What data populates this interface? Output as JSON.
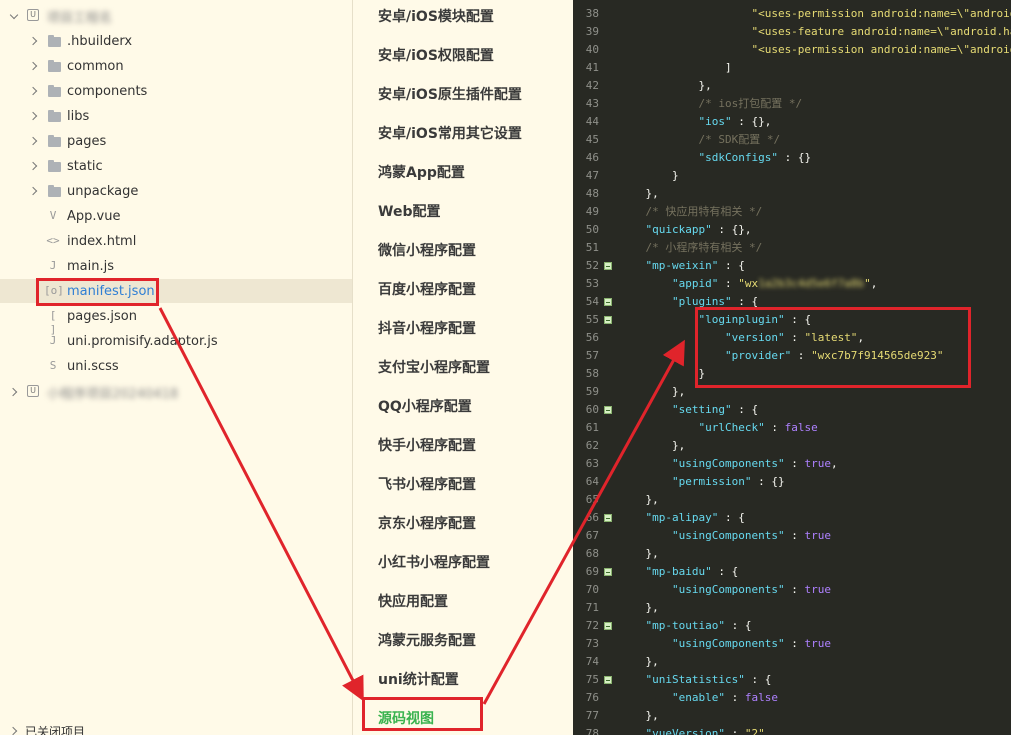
{
  "explorer": {
    "project_name": "项目工程名",
    "items": [
      {
        "label": ".hbuilderx",
        "kind": "folder"
      },
      {
        "label": "common",
        "kind": "folder"
      },
      {
        "label": "components",
        "kind": "folder"
      },
      {
        "label": "libs",
        "kind": "folder"
      },
      {
        "label": "pages",
        "kind": "folder"
      },
      {
        "label": "static",
        "kind": "folder"
      },
      {
        "label": "unpackage",
        "kind": "folder"
      },
      {
        "label": "App.vue",
        "kind": "vue-file"
      },
      {
        "label": "index.html",
        "kind": "html-file"
      },
      {
        "label": "main.js",
        "kind": "js-file"
      },
      {
        "label": "manifest.json",
        "kind": "manifest-file"
      },
      {
        "label": "pages.json",
        "kind": "json-file"
      },
      {
        "label": "uni.promisify.adaptor.js",
        "kind": "js-file"
      },
      {
        "label": "uni.scss",
        "kind": "scss-file"
      }
    ],
    "second_project_name": "小程序项目20240418",
    "closed_projects_label": "已关闭项目"
  },
  "config_menu": {
    "items": [
      "安卓/iOS模块配置",
      "安卓/iOS权限配置",
      "安卓/iOS原生插件配置",
      "安卓/iOS常用其它设置",
      "鸿蒙App配置",
      "Web配置",
      "微信小程序配置",
      "百度小程序配置",
      "抖音小程序配置",
      "支付宝小程序配置",
      "QQ小程序配置",
      "快手小程序配置",
      "飞书小程序配置",
      "京东小程序配置",
      "小红书小程序配置",
      "快应用配置",
      "鸿蒙元服务配置",
      "uni统计配置",
      "源码视图"
    ],
    "active_item": "源码视图"
  },
  "editor": {
    "lines": [
      {
        "n": "38",
        "fold": false,
        "parts": [
          [
            "s",
            "                    \"<uses-permission android:name=\\\"android.permission.ACCESS_FINE_LOCATION\\\"/>\","
          ]
        ]
      },
      {
        "n": "39",
        "fold": false,
        "parts": [
          [
            "s",
            "                    \"<uses-feature android:name=\\\"android.hardware.location\\\"/>\","
          ]
        ]
      },
      {
        "n": "40",
        "fold": false,
        "parts": [
          [
            "s",
            "                    \"<uses-permission android:name=\\\"android.permission.ACCESS_WIFI_STATE\\\"/>\""
          ]
        ]
      },
      {
        "n": "41",
        "fold": false,
        "parts": [
          [
            "p",
            "                ]"
          ]
        ]
      },
      {
        "n": "42",
        "fold": false,
        "parts": [
          [
            "p",
            "            },"
          ]
        ]
      },
      {
        "n": "43",
        "fold": false,
        "parts": [
          [
            "c",
            "            /* ios打包配置 */"
          ]
        ]
      },
      {
        "n": "44",
        "fold": false,
        "parts": [
          [
            "k",
            "            \"ios\""
          ],
          [
            "p",
            " : {},"
          ]
        ]
      },
      {
        "n": "45",
        "fold": false,
        "parts": [
          [
            "c",
            "            /* SDK配置 */"
          ]
        ]
      },
      {
        "n": "46",
        "fold": false,
        "parts": [
          [
            "k",
            "            \"sdkConfigs\""
          ],
          [
            "p",
            " : {}"
          ]
        ]
      },
      {
        "n": "47",
        "fold": false,
        "parts": [
          [
            "p",
            "        }"
          ]
        ]
      },
      {
        "n": "48",
        "fold": false,
        "parts": [
          [
            "p",
            "    },"
          ]
        ]
      },
      {
        "n": "49",
        "fold": false,
        "parts": [
          [
            "c",
            "    /* 快应用特有相关 */"
          ]
        ]
      },
      {
        "n": "50",
        "fold": false,
        "parts": [
          [
            "k",
            "    \"quickapp\""
          ],
          [
            "p",
            " : {},"
          ]
        ]
      },
      {
        "n": "51",
        "fold": false,
        "parts": [
          [
            "c",
            "    /* 小程序特有相关 */"
          ]
        ]
      },
      {
        "n": "52",
        "fold": true,
        "parts": [
          [
            "k",
            "    \"mp-weixin\""
          ],
          [
            "p",
            " : {"
          ]
        ]
      },
      {
        "n": "53",
        "fold": false,
        "parts": [
          [
            "k",
            "        \"appid\""
          ],
          [
            "p",
            " : "
          ],
          [
            "s",
            "\"wx"
          ],
          [
            "blur",
            "1a2b3c4d5e6f7a8b"
          ],
          [
            "s",
            "\""
          ],
          [
            "p",
            ","
          ]
        ]
      },
      {
        "n": "54",
        "fold": true,
        "parts": [
          [
            "k",
            "        \"plugins\""
          ],
          [
            "p",
            " : {"
          ]
        ]
      },
      {
        "n": "55",
        "fold": true,
        "parts": [
          [
            "k",
            "            \"loginplugin\""
          ],
          [
            "p",
            " : {"
          ]
        ]
      },
      {
        "n": "56",
        "fold": false,
        "parts": [
          [
            "k",
            "                \"version\""
          ],
          [
            "p",
            " : "
          ],
          [
            "s",
            "\"latest\""
          ],
          [
            "p",
            ","
          ]
        ]
      },
      {
        "n": "57",
        "fold": false,
        "parts": [
          [
            "k",
            "                \"provider\""
          ],
          [
            "p",
            " : "
          ],
          [
            "s",
            "\"wxc7b7f914565de923\""
          ]
        ]
      },
      {
        "n": "58",
        "fold": false,
        "parts": [
          [
            "p",
            "            }"
          ]
        ]
      },
      {
        "n": "59",
        "fold": false,
        "parts": [
          [
            "p",
            "        },"
          ]
        ]
      },
      {
        "n": "60",
        "fold": true,
        "parts": [
          [
            "k",
            "        \"setting\""
          ],
          [
            "p",
            " : {"
          ]
        ]
      },
      {
        "n": "61",
        "fold": false,
        "parts": [
          [
            "k",
            "            \"urlCheck\""
          ],
          [
            "p",
            " : "
          ],
          [
            "b",
            "false"
          ]
        ]
      },
      {
        "n": "62",
        "fold": false,
        "parts": [
          [
            "p",
            "        },"
          ]
        ]
      },
      {
        "n": "63",
        "fold": false,
        "parts": [
          [
            "k",
            "        \"usingComponents\""
          ],
          [
            "p",
            " : "
          ],
          [
            "b",
            "true"
          ],
          [
            "p",
            ","
          ]
        ]
      },
      {
        "n": "64",
        "fold": false,
        "parts": [
          [
            "k",
            "        \"permission\""
          ],
          [
            "p",
            " : {}"
          ]
        ]
      },
      {
        "n": "65",
        "fold": false,
        "parts": [
          [
            "p",
            "    },"
          ]
        ]
      },
      {
        "n": "66",
        "fold": true,
        "parts": [
          [
            "k",
            "    \"mp-alipay\""
          ],
          [
            "p",
            " : {"
          ]
        ]
      },
      {
        "n": "67",
        "fold": false,
        "parts": [
          [
            "k",
            "        \"usingComponents\""
          ],
          [
            "p",
            " : "
          ],
          [
            "b",
            "true"
          ]
        ]
      },
      {
        "n": "68",
        "fold": false,
        "parts": [
          [
            "p",
            "    },"
          ]
        ]
      },
      {
        "n": "69",
        "fold": true,
        "parts": [
          [
            "k",
            "    \"mp-baidu\""
          ],
          [
            "p",
            " : {"
          ]
        ]
      },
      {
        "n": "70",
        "fold": false,
        "parts": [
          [
            "k",
            "        \"usingComponents\""
          ],
          [
            "p",
            " : "
          ],
          [
            "b",
            "true"
          ]
        ]
      },
      {
        "n": "71",
        "fold": false,
        "parts": [
          [
            "p",
            "    },"
          ]
        ]
      },
      {
        "n": "72",
        "fold": true,
        "parts": [
          [
            "k",
            "    \"mp-toutiao\""
          ],
          [
            "p",
            " : {"
          ]
        ]
      },
      {
        "n": "73",
        "fold": false,
        "parts": [
          [
            "k",
            "        \"usingComponents\""
          ],
          [
            "p",
            " : "
          ],
          [
            "b",
            "true"
          ]
        ]
      },
      {
        "n": "74",
        "fold": false,
        "parts": [
          [
            "p",
            "    },"
          ]
        ]
      },
      {
        "n": "75",
        "fold": true,
        "parts": [
          [
            "k",
            "    \"uniStatistics\""
          ],
          [
            "p",
            " : {"
          ]
        ]
      },
      {
        "n": "76",
        "fold": false,
        "parts": [
          [
            "k",
            "        \"enable\""
          ],
          [
            "p",
            " : "
          ],
          [
            "b",
            "false"
          ]
        ]
      },
      {
        "n": "77",
        "fold": false,
        "parts": [
          [
            "p",
            "    },"
          ]
        ]
      },
      {
        "n": "78",
        "fold": false,
        "parts": [
          [
            "k",
            "    \"vueVersion\""
          ],
          [
            "p",
            " : "
          ],
          [
            "s",
            "\"2\""
          ]
        ]
      }
    ]
  },
  "colors": {
    "annotation": "#e0242b",
    "active_menu": "#3ab34f",
    "editor_bg": "#282923",
    "panel_bg": "#fffae8"
  }
}
